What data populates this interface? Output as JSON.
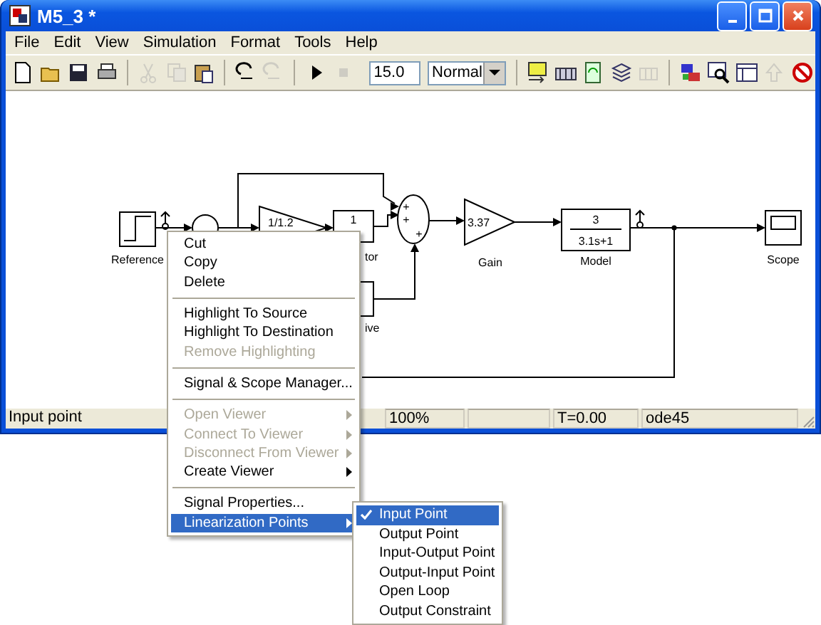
{
  "window": {
    "title": "M5_3 *"
  },
  "menu_bar": [
    "File",
    "Edit",
    "View",
    "Simulation",
    "Format",
    "Tools",
    "Help"
  ],
  "toolbar": {
    "left_groups": [
      [
        {
          "disabled": false
        },
        {
          "disabled": false
        },
        {
          "disabled": false
        },
        {
          "disabled": false
        }
      ],
      [
        {
          "disabled": true
        },
        {
          "disabled": true
        },
        {
          "disabled": false
        }
      ],
      [
        {
          "disabled": false
        },
        {
          "disabled": true
        }
      ],
      [
        {
          "disabled": false
        },
        {
          "disabled": true
        }
      ]
    ],
    "stop_time": "15.0",
    "mode": "Normal",
    "right_groups": [
      [
        {
          "disabled": false
        },
        {
          "disabled": false
        },
        {
          "disabled": false
        },
        {
          "disabled": false
        },
        {
          "disabled": true
        }
      ],
      [
        {
          "disabled": false
        },
        {
          "disabled": false
        },
        {
          "disabled": false
        },
        {
          "disabled": true
        },
        {
          "disabled": false
        }
      ]
    ]
  },
  "diagram": {
    "reference": {
      "label": "Reference"
    },
    "partial_gain": {
      "value": "1/1.2"
    },
    "integrator": {
      "value": "1",
      "label_fragment": "tor"
    },
    "derivative": {
      "label_fragment": "ive"
    },
    "sum": {
      "signs": [
        "+",
        "+",
        "+"
      ]
    },
    "gain": {
      "value": "3.37",
      "label": "Gain"
    },
    "model": {
      "numerator": "3",
      "denominator": "3.1s+1",
      "label": "Model"
    },
    "scope": {
      "label": "Scope"
    }
  },
  "status_bar": {
    "message": "Input point",
    "panes": [
      "100%",
      "T=0.00",
      "ode45"
    ]
  },
  "context_menu": {
    "items": [
      {
        "kind": "item",
        "label": "Cut",
        "disabled": false,
        "submenu": false,
        "selected": false
      },
      {
        "kind": "item",
        "label": "Copy",
        "disabled": false,
        "submenu": false,
        "selected": false
      },
      {
        "kind": "item",
        "label": "Delete",
        "disabled": false,
        "submenu": false,
        "selected": false
      },
      {
        "kind": "separator"
      },
      {
        "kind": "item",
        "label": "Highlight To Source",
        "disabled": false,
        "submenu": false,
        "selected": false
      },
      {
        "kind": "item",
        "label": "Highlight To Destination",
        "disabled": false,
        "submenu": false,
        "selected": false
      },
      {
        "kind": "item",
        "label": "Remove Highlighting",
        "disabled": true,
        "submenu": false,
        "selected": false
      },
      {
        "kind": "separator"
      },
      {
        "kind": "item",
        "label": "Signal & Scope Manager...",
        "disabled": false,
        "submenu": false,
        "selected": false
      },
      {
        "kind": "separator"
      },
      {
        "kind": "item",
        "label": "Open Viewer",
        "disabled": true,
        "submenu": true,
        "selected": false
      },
      {
        "kind": "item",
        "label": "Connect To Viewer",
        "disabled": true,
        "submenu": true,
        "selected": false
      },
      {
        "kind": "item",
        "label": "Disconnect From Viewer",
        "disabled": true,
        "submenu": true,
        "selected": false
      },
      {
        "kind": "item",
        "label": "Create Viewer",
        "disabled": false,
        "submenu": true,
        "selected": false
      },
      {
        "kind": "separator"
      },
      {
        "kind": "item",
        "label": "Signal Properties...",
        "disabled": false,
        "submenu": false,
        "selected": false
      },
      {
        "kind": "item",
        "label": "Linearization Points",
        "disabled": false,
        "submenu": true,
        "selected": true
      }
    ]
  },
  "submenu": {
    "items": [
      {
        "label": "Input Point",
        "checked": true,
        "selected": true
      },
      {
        "label": "Output Point",
        "checked": false,
        "selected": false
      },
      {
        "label": "Input-Output Point",
        "checked": false,
        "selected": false
      },
      {
        "label": "Output-Input Point",
        "checked": false,
        "selected": false
      },
      {
        "label": "Open Loop",
        "checked": false,
        "selected": false
      },
      {
        "label": "Output Constraint",
        "checked": false,
        "selected": false
      }
    ]
  }
}
